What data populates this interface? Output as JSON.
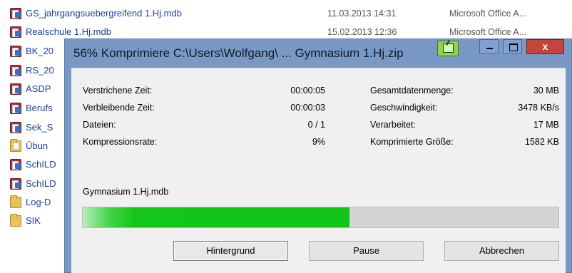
{
  "explorer": {
    "files": [
      {
        "name": "GS_jahrgangsuebergreifend 1.Hj.mdb",
        "date": "11.03.2013 14:31",
        "type": "Microsoft Office A...",
        "icon": "access-db-icon"
      },
      {
        "name": "Realschule 1.Hj.mdb",
        "date": "15.02.2013 12:36",
        "type": "Microsoft Office A...",
        "icon": "access-db-icon"
      },
      {
        "name": "BK_20",
        "icon": "access-db-icon"
      },
      {
        "name": "RS_20",
        "icon": "access-db-icon"
      },
      {
        "name": "ASDP",
        "icon": "access-db-icon"
      },
      {
        "name": "Berufs",
        "icon": "access-db-icon"
      },
      {
        "name": "Sek_S",
        "icon": "access-db-icon"
      },
      {
        "name": "Übun",
        "icon": "folder-icon"
      },
      {
        "name": "SchILD",
        "icon": "access-db-icon"
      },
      {
        "name": "SchILD",
        "icon": "access-db-icon"
      },
      {
        "name": "Log-D",
        "icon": "folder-icon"
      },
      {
        "name": "SIK",
        "icon": "folder-icon"
      }
    ]
  },
  "dialog": {
    "title": "56% Komprimiere C:\\Users\\Wolfgang\\ ... Gymnasium 1.Hj.zip",
    "close_label": "x",
    "stats_left": [
      {
        "label": "Verstrichene Zeit:",
        "value": "00:00:05"
      },
      {
        "label": "Verbleibende Zeit:",
        "value": "00:00:03"
      },
      {
        "label": "Dateien:",
        "value": "0 / 1"
      },
      {
        "label": "Kompressionsrate:",
        "value": "9%"
      }
    ],
    "stats_right": [
      {
        "label": "Gesamtdatenmenge:",
        "value": "30 MB"
      },
      {
        "label": "Geschwindigkeit:",
        "value": "3478 KB/s"
      },
      {
        "label": "Verarbeitet:",
        "value": "17 MB"
      },
      {
        "label": "Komprimierte Größe:",
        "value": "1582 KB"
      }
    ],
    "current_file": "Gymnasium 1.Hj.mdb",
    "progress_percent": 56,
    "buttons": {
      "background": "Hintergrund",
      "pause": "Pause",
      "cancel": "Abbrechen"
    }
  },
  "colors": {
    "titlebar": "#7a98c4",
    "progress_fill": "#11c417",
    "progress_track": "#d4d4d4",
    "close_button": "#c7443a",
    "file_link": "#1a3e9a"
  }
}
